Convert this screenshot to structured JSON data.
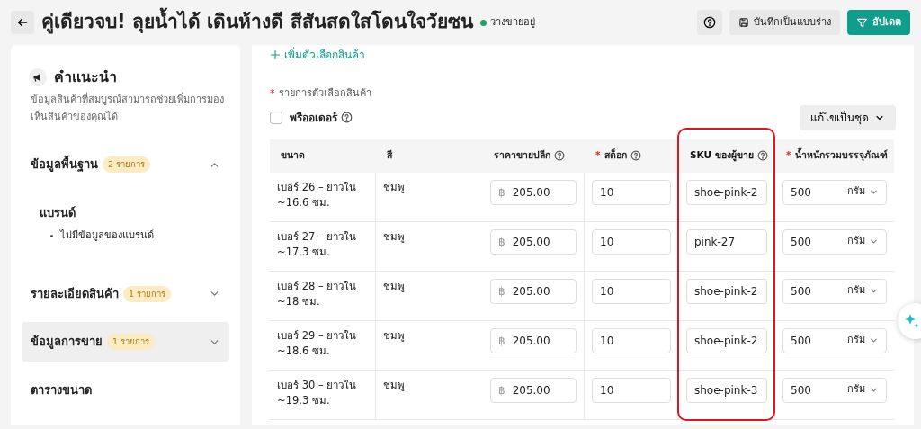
{
  "header": {
    "title": "คู่เดียวจบ! ลุยน้ำได้ เดินห้างดี สีสันสดใสโดนใจวัยซน",
    "status": {
      "label": "วางขายอยู่",
      "color": "#22a06b"
    },
    "buttons": [
      {
        "label": "บันทึกเป็นแบบร่าง",
        "kind": "secondary"
      },
      {
        "label": "อัปเดต",
        "kind": "primary"
      }
    ]
  },
  "sidebar": {
    "title": "คำแนะนำ",
    "description": "ข้อมูลสินค้าที่สมบูรณ์สามารถช่วยเพิ่มการมองเห็นสินค้าของคุณได้",
    "sections": [
      {
        "label": "ข้อมูลพื้นฐาน",
        "badge": "2 รายการ",
        "expanded": true,
        "selected": false,
        "children": [
          {
            "title": "แบรนด์",
            "bullets": [
              "ไม่มีข้อมูลของแบรนด์"
            ]
          }
        ]
      },
      {
        "label": "รายละเอียดสินค้า",
        "badge": "1 รายการ",
        "expanded": false,
        "selected": false
      },
      {
        "label": "ข้อมูลการขาย",
        "badge": "1 รายการ",
        "expanded": false,
        "selected": true
      },
      {
        "label": "ตารางขนาด",
        "selected": false
      }
    ]
  },
  "main": {
    "add_option_link": "เพิ่มตัวเลือกสินค้า",
    "variants_label": {
      "text": "รายการตัวเลือกสินค้า",
      "required_mark": "*"
    },
    "preorder": {
      "label": "พรีออเดอร์",
      "checked": false
    },
    "bulk_edit_button": "แก้ไขเป็นชุด",
    "table": {
      "columns": [
        {
          "label": "ขนาด",
          "help": false,
          "highlighted": false
        },
        {
          "label": "สี",
          "help": false,
          "highlighted": false
        },
        {
          "label": "ราคาขายปลีก",
          "help": true,
          "highlighted": false
        },
        {
          "label": "สต็อก",
          "required_mark": "*",
          "help": true,
          "highlighted": false
        },
        {
          "label": "SKU ของผู้ขาย",
          "help": true,
          "highlighted": true
        },
        {
          "label": "น้ำหนักรวมบรรจุภัณฑ์",
          "required_mark": "*",
          "help": false,
          "highlighted": false
        }
      ],
      "rows": [
        {
          "size": "เบอร์ 26 – ยาวใน ~16.6 ซม.",
          "variant_colour": "ชมพู",
          "currency": "฿",
          "price": "205.00",
          "stock": "10",
          "sku": "shoe-pink-2",
          "weight": "500",
          "unit": "กรัม"
        },
        {
          "size": "เบอร์ 27 – ยาวใน ~17.3 ซม.",
          "variant_colour": "ชมพู",
          "currency": "฿",
          "price": "205.00",
          "stock": "10",
          "sku": "pink-27",
          "weight": "500",
          "unit": "กรัม"
        },
        {
          "size": "เบอร์ 28 – ยาวใน ~18 ซม.",
          "variant_colour": "ชมพู",
          "currency": "฿",
          "price": "205.00",
          "stock": "10",
          "sku": "shoe-pink-2",
          "weight": "500",
          "unit": "กรัม"
        },
        {
          "size": "เบอร์ 29 – ยาวใน ~18.6 ซม.",
          "variant_colour": "ชมพู",
          "currency": "฿",
          "price": "205.00",
          "stock": "10",
          "sku": "shoe-pink-2",
          "weight": "500",
          "unit": "กรัม"
        },
        {
          "size": "เบอร์ 30 – ยาวใน ~19.3 ซม.",
          "variant_colour": "ชมพู",
          "currency": "฿",
          "price": "205.00",
          "stock": "10",
          "sku": "shoe-pink-3",
          "weight": "500",
          "unit": "กรัม"
        }
      ]
    }
  }
}
